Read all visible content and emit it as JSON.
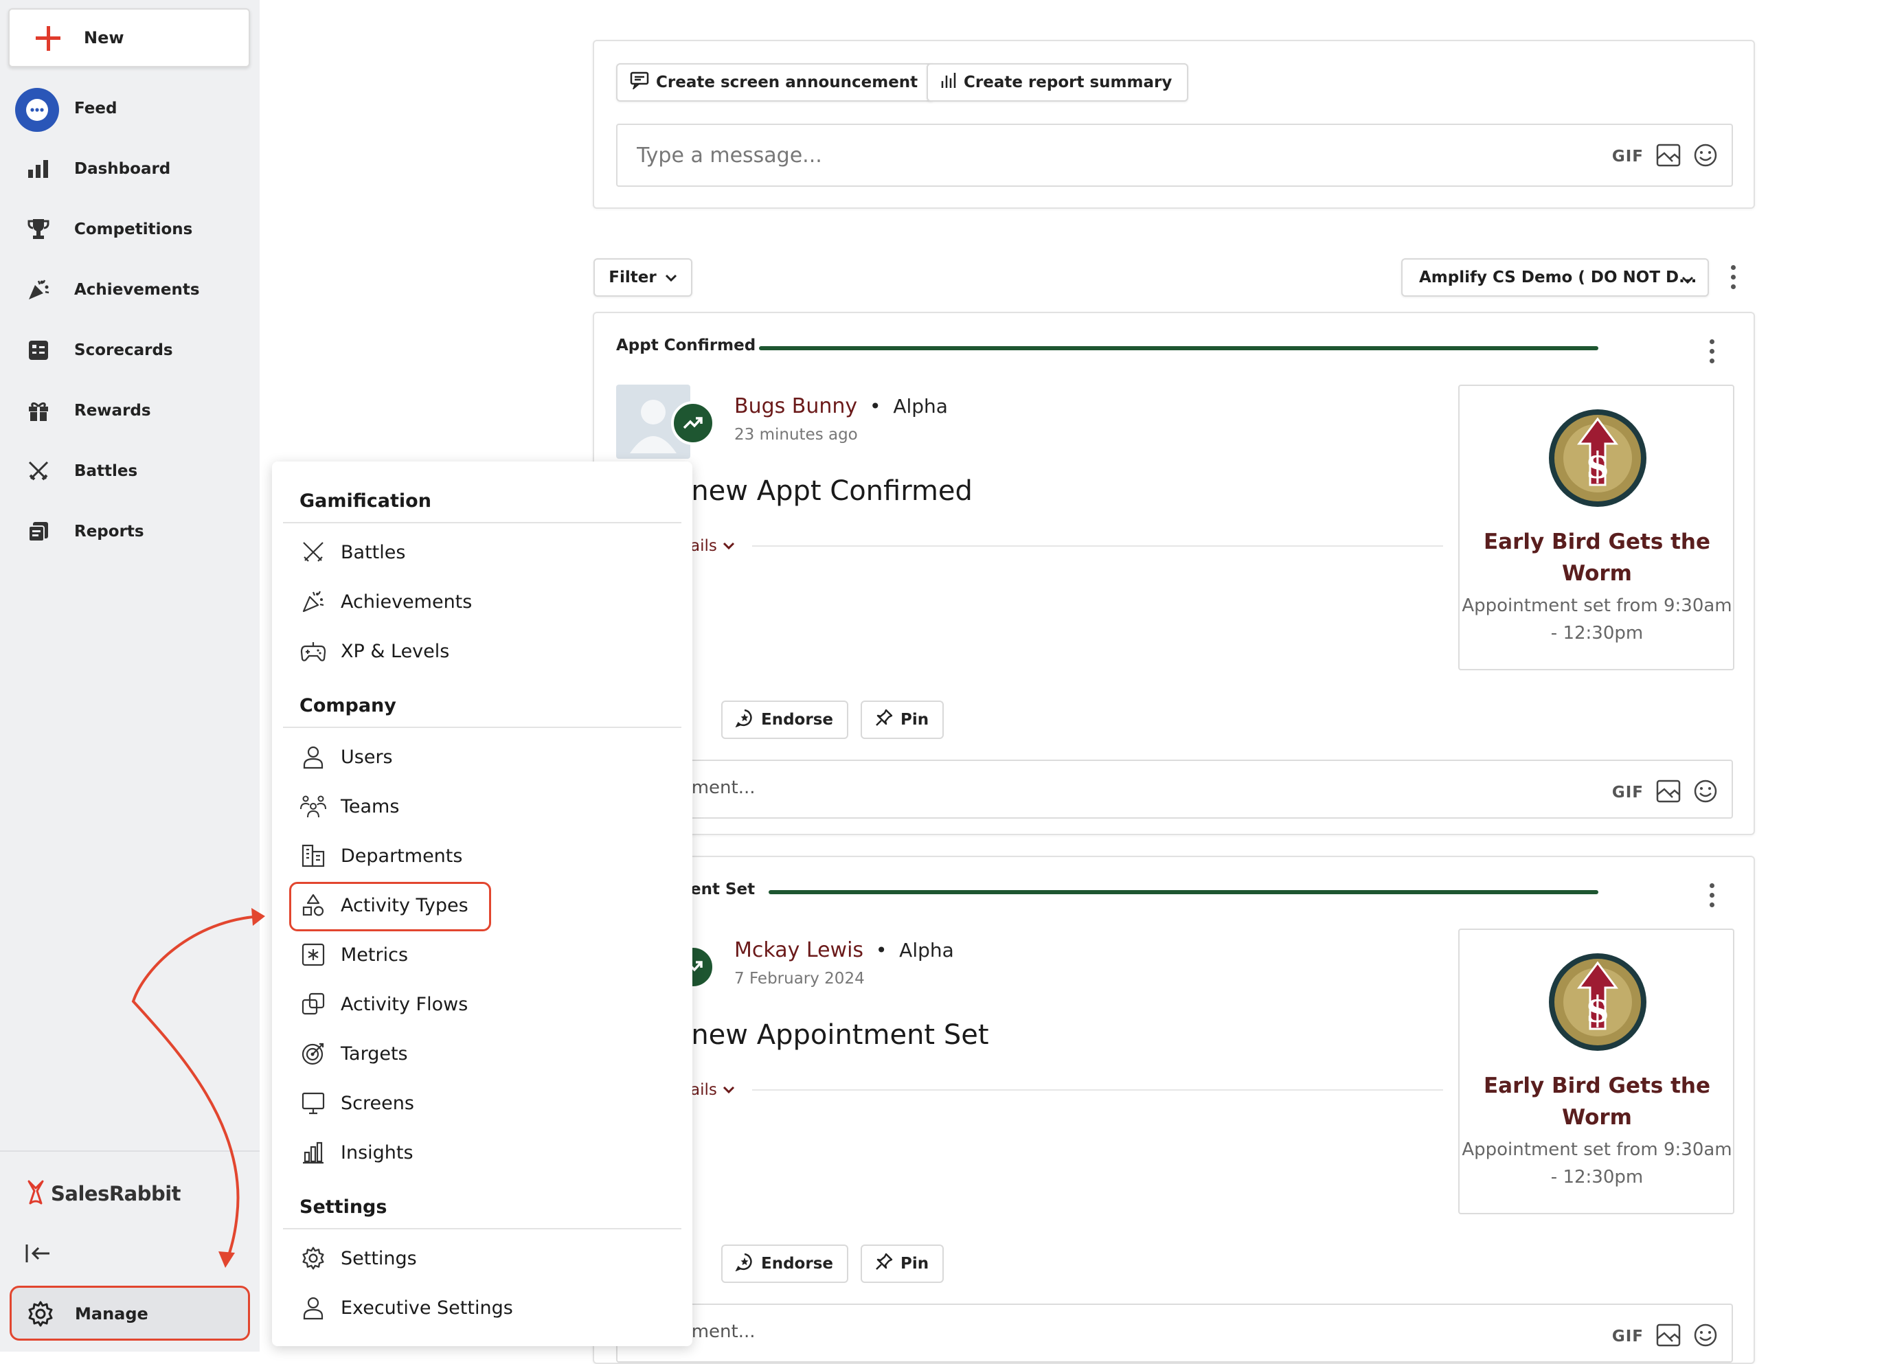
{
  "sidebar": {
    "new_label": "New",
    "items": [
      {
        "label": "Feed",
        "icon": "chat-bubble-icon"
      },
      {
        "label": "Dashboard",
        "icon": "bar-chart-icon"
      },
      {
        "label": "Competitions",
        "icon": "trophy-icon"
      },
      {
        "label": "Achievements",
        "icon": "party-popper-icon"
      },
      {
        "label": "Scorecards",
        "icon": "scorecard-icon"
      },
      {
        "label": "Rewards",
        "icon": "gift-icon"
      },
      {
        "label": "Battles",
        "icon": "crossed-swords-icon"
      },
      {
        "label": "Reports",
        "icon": "reports-icon"
      }
    ],
    "brand": "SalesRabbit",
    "manage_label": "Manage"
  },
  "composer": {
    "announcement_label": "Create screen announcement",
    "report_label": "Create report summary",
    "placeholder": "Type a message...",
    "gif_label": "GIF"
  },
  "feed_controls": {
    "filter_label": "Filter",
    "workspace_label": "Amplify CS Demo ( DO NOT D..."
  },
  "posts": [
    {
      "type": "Appt Confirmed",
      "user": "Bugs Bunny",
      "team": "Alpha",
      "time": "23 minutes ago",
      "headline": "d a new Appt Confirmed",
      "details_label": "ails",
      "award_name": "Early Bird Gets the Worm",
      "award_desc": "Appointment set from 9:30am - 12:30pm",
      "endorse_label": "Endorse",
      "pin_label": "Pin",
      "comment_placeholder": "a comment...",
      "gif_label": "GIF"
    },
    {
      "type": "ent Set",
      "user": "Mckay Lewis",
      "team": "Alpha",
      "time": "7 February 2024",
      "headline": "d a new Appointment Set",
      "details_label": "ails",
      "award_name": "Early Bird Gets the Worm",
      "award_desc": "Appointment set from 9:30am - 12:30pm",
      "endorse_label": "Endorse",
      "pin_label": "Pin",
      "comment_placeholder": "a comment...",
      "gif_label": "GIF"
    }
  ],
  "manage_menu": {
    "sections": [
      {
        "title": "Gamification",
        "items": [
          {
            "label": "Battles",
            "icon": "crossed-swords-icon"
          },
          {
            "label": "Achievements",
            "icon": "party-popper-icon"
          },
          {
            "label": "XP & Levels",
            "icon": "gamepad-icon"
          }
        ]
      },
      {
        "title": "Company",
        "items": [
          {
            "label": "Users",
            "icon": "user-icon"
          },
          {
            "label": "Teams",
            "icon": "team-icon"
          },
          {
            "label": "Departments",
            "icon": "building-icon"
          },
          {
            "label": "Activity Types",
            "icon": "shapes-icon"
          },
          {
            "label": "Metrics",
            "icon": "metric-icon"
          },
          {
            "label": "Activity Flows",
            "icon": "flow-icon"
          },
          {
            "label": "Targets",
            "icon": "target-icon"
          },
          {
            "label": "Screens",
            "icon": "monitor-icon"
          },
          {
            "label": "Insights",
            "icon": "insights-icon"
          }
        ]
      },
      {
        "title": "Settings",
        "items": [
          {
            "label": "Settings",
            "icon": "gear-icon"
          },
          {
            "label": "Executive Settings",
            "icon": "user-icon"
          }
        ]
      }
    ]
  },
  "colors": {
    "accent_green": "#1e5631",
    "highlight_red": "#e2462f",
    "feed_blue": "#2a56b8",
    "user_name": "#6b1a1a"
  }
}
